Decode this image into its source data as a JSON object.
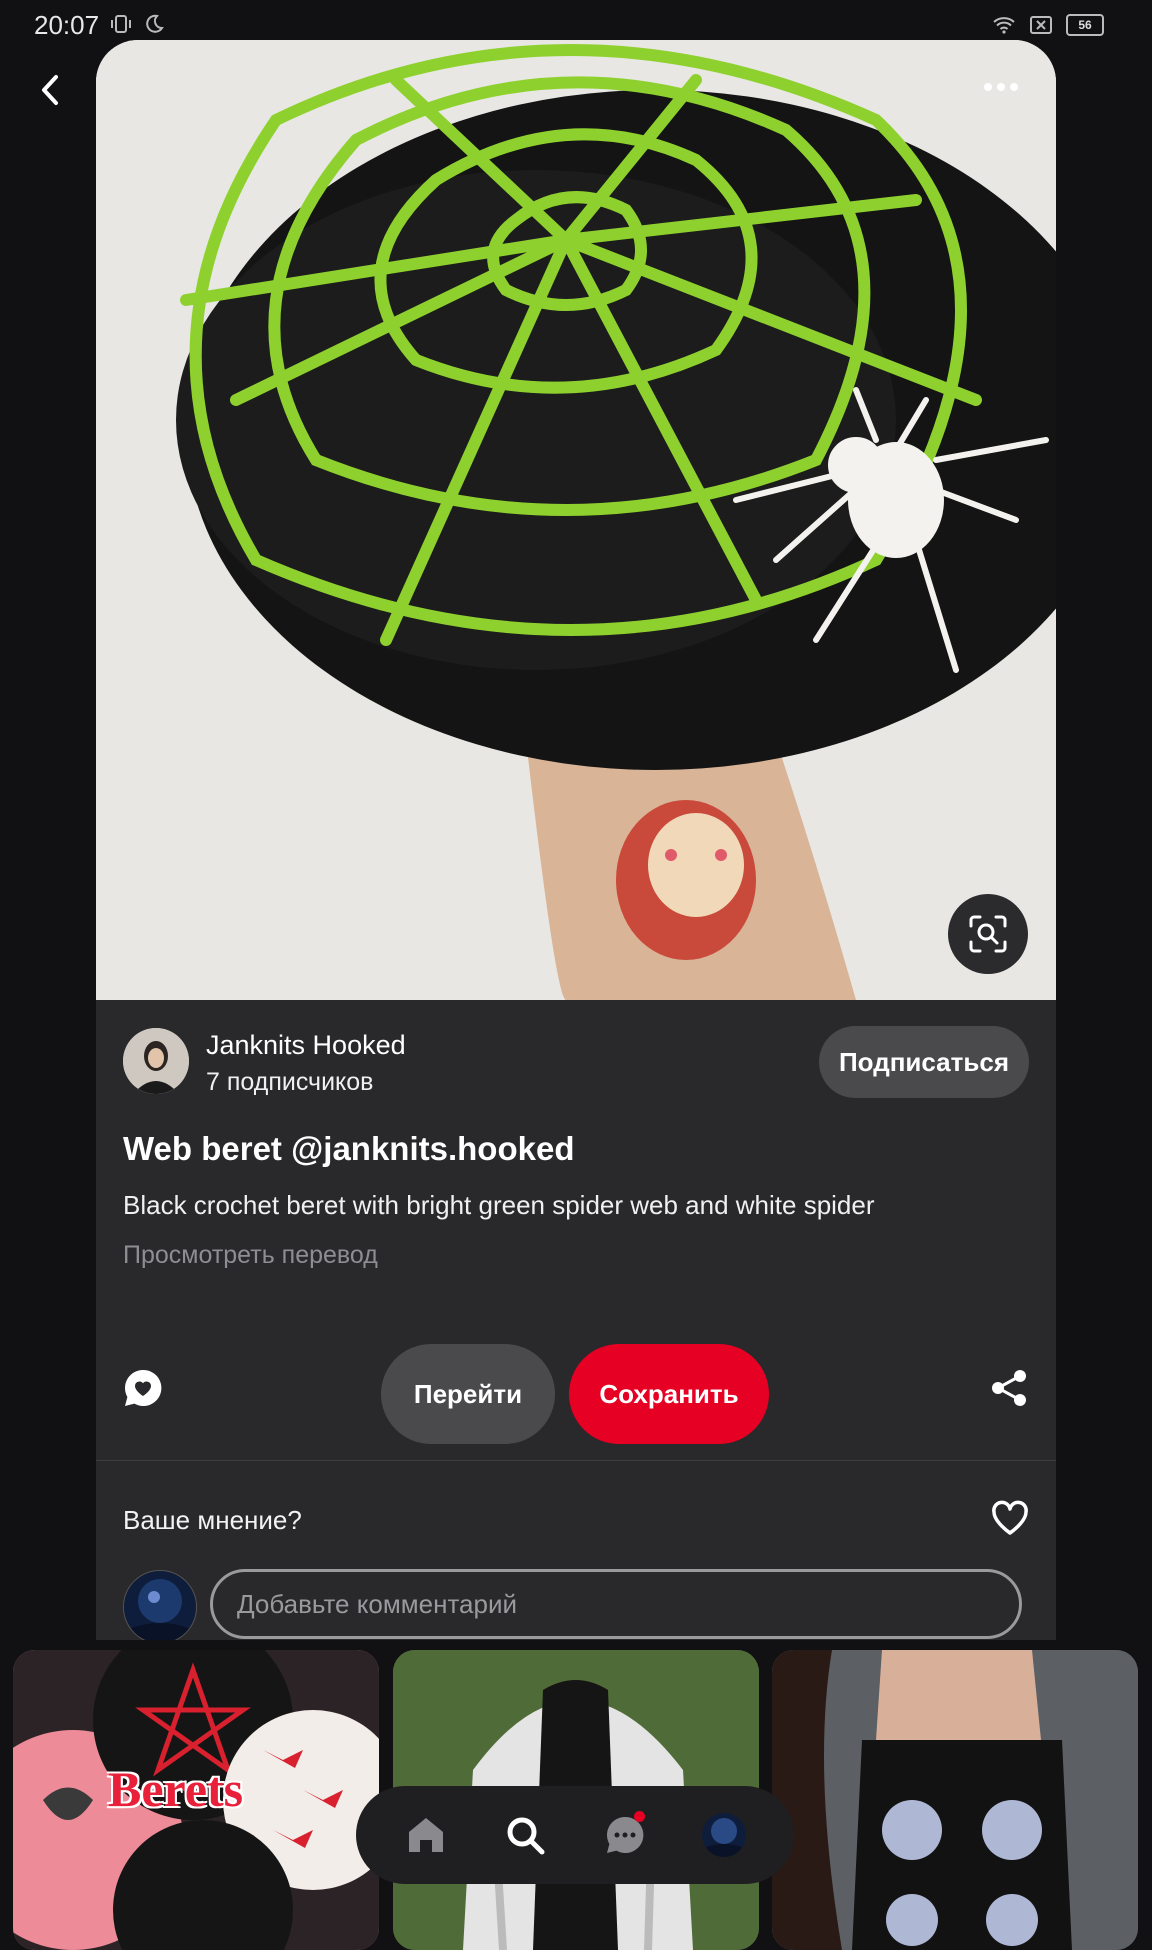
{
  "status_bar": {
    "time": "20:07",
    "battery": "56"
  },
  "pin": {
    "author_name": "Janknits Hooked",
    "followers": "7 подписчиков",
    "follow_label": "Подписаться",
    "title": "Web beret @janknits.hooked",
    "description": "Black crochet beret with bright green spider web and white spider",
    "translate_label": "Просмотреть перевод"
  },
  "actions": {
    "go_label": "Перейти",
    "save_label": "Сохранить"
  },
  "comments": {
    "prompt": "Ваше мнение?",
    "placeholder": "Добавьте комментарий"
  },
  "related": [
    {
      "label": "Berets"
    },
    {
      "label": ""
    },
    {
      "label": ""
    }
  ],
  "bottom_nav": [
    "home-icon",
    "search-icon",
    "messages-icon",
    "profile-avatar"
  ],
  "colors": {
    "accent": "#e60023",
    "background": "#111013",
    "card": "#29282b"
  }
}
